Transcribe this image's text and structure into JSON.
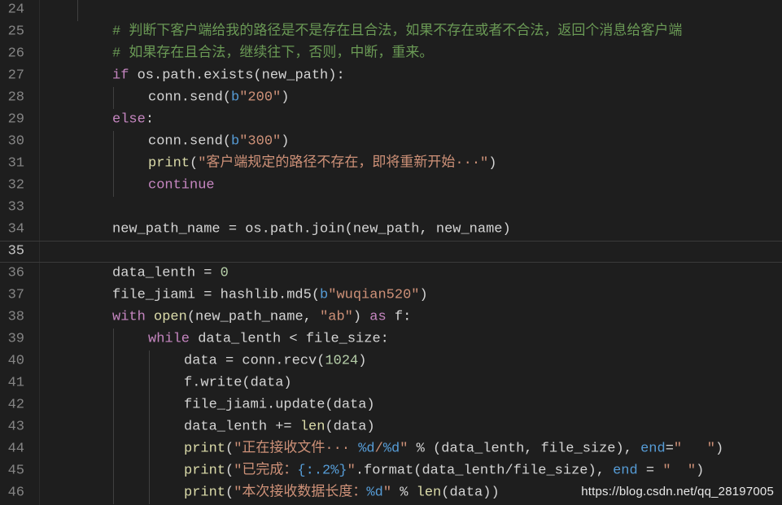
{
  "editor": {
    "lines": [
      {
        "n": "24",
        "indent": 0,
        "tokens": []
      },
      {
        "n": "25",
        "indent": 2,
        "tokens": [
          {
            "t": "# 判断下客户端给我的路径是不是存在且合法，如果不存在或者不合法，返回个消息给客户端",
            "c": "com"
          }
        ]
      },
      {
        "n": "26",
        "indent": 2,
        "tokens": [
          {
            "t": "# 如果存在且合法，继续往下，否则，中断，重来。",
            "c": "com"
          }
        ]
      },
      {
        "n": "27",
        "indent": 2,
        "tokens": [
          {
            "t": "if",
            "c": "kw"
          },
          {
            "t": " os.path.exists(new_path):",
            "c": "id"
          }
        ]
      },
      {
        "n": "28",
        "indent": 3,
        "tokens": [
          {
            "t": "conn.send(",
            "c": "id"
          },
          {
            "t": "b",
            "c": "fmt"
          },
          {
            "t": "\"200\"",
            "c": "str"
          },
          {
            "t": ")",
            "c": "id"
          }
        ]
      },
      {
        "n": "29",
        "indent": 2,
        "tokens": [
          {
            "t": "else",
            "c": "kw"
          },
          {
            "t": ":",
            "c": "id"
          }
        ]
      },
      {
        "n": "30",
        "indent": 3,
        "tokens": [
          {
            "t": "conn.send(",
            "c": "id"
          },
          {
            "t": "b",
            "c": "fmt"
          },
          {
            "t": "\"300\"",
            "c": "str"
          },
          {
            "t": ")",
            "c": "id"
          }
        ]
      },
      {
        "n": "31",
        "indent": 3,
        "tokens": [
          {
            "t": "print",
            "c": "bi"
          },
          {
            "t": "(",
            "c": "id"
          },
          {
            "t": "\"客户端规定的路径不存在，即将重新开始···\"",
            "c": "str"
          },
          {
            "t": ")",
            "c": "id"
          }
        ]
      },
      {
        "n": "32",
        "indent": 3,
        "tokens": [
          {
            "t": "continue",
            "c": "kw"
          }
        ]
      },
      {
        "n": "33",
        "indent": 0,
        "tokens": []
      },
      {
        "n": "34",
        "indent": 2,
        "tokens": [
          {
            "t": "new_path_name = os.path.join(new_path, new_name)",
            "c": "id"
          }
        ]
      },
      {
        "n": "35",
        "indent": 0,
        "tokens": [],
        "current": true
      },
      {
        "n": "36",
        "indent": 2,
        "tokens": [
          {
            "t": "data_lenth = ",
            "c": "id"
          },
          {
            "t": "0",
            "c": "num"
          }
        ]
      },
      {
        "n": "37",
        "indent": 2,
        "tokens": [
          {
            "t": "file_jiami = hashlib.md5(",
            "c": "id"
          },
          {
            "t": "b",
            "c": "fmt"
          },
          {
            "t": "\"wuqian520\"",
            "c": "str"
          },
          {
            "t": ")",
            "c": "id"
          }
        ]
      },
      {
        "n": "38",
        "indent": 2,
        "tokens": [
          {
            "t": "with",
            "c": "kw"
          },
          {
            "t": " ",
            "c": "id"
          },
          {
            "t": "open",
            "c": "bi"
          },
          {
            "t": "(new_path_name, ",
            "c": "id"
          },
          {
            "t": "\"ab\"",
            "c": "str"
          },
          {
            "t": ") ",
            "c": "id"
          },
          {
            "t": "as",
            "c": "kw"
          },
          {
            "t": " f:",
            "c": "id"
          }
        ]
      },
      {
        "n": "39",
        "indent": 3,
        "tokens": [
          {
            "t": "while",
            "c": "kw"
          },
          {
            "t": " data_lenth < file_size:",
            "c": "id"
          }
        ]
      },
      {
        "n": "40",
        "indent": 4,
        "tokens": [
          {
            "t": "data = conn.recv(",
            "c": "id"
          },
          {
            "t": "1024",
            "c": "num"
          },
          {
            "t": ")",
            "c": "id"
          }
        ]
      },
      {
        "n": "41",
        "indent": 4,
        "tokens": [
          {
            "t": "f.write(data)",
            "c": "id"
          }
        ]
      },
      {
        "n": "42",
        "indent": 4,
        "tokens": [
          {
            "t": "file_jiami.update(data)",
            "c": "id"
          }
        ]
      },
      {
        "n": "43",
        "indent": 4,
        "tokens": [
          {
            "t": "data_lenth += ",
            "c": "id"
          },
          {
            "t": "len",
            "c": "bi"
          },
          {
            "t": "(data)",
            "c": "id"
          }
        ]
      },
      {
        "n": "44",
        "indent": 4,
        "tokens": [
          {
            "t": "print",
            "c": "bi"
          },
          {
            "t": "(",
            "c": "id"
          },
          {
            "t": "\"正在接收文件··· ",
            "c": "str"
          },
          {
            "t": "%d",
            "c": "fmt"
          },
          {
            "t": "/",
            "c": "str"
          },
          {
            "t": "%d",
            "c": "fmt"
          },
          {
            "t": "\"",
            "c": "str"
          },
          {
            "t": " % (data_lenth, file_size), ",
            "c": "id"
          },
          {
            "t": "end",
            "c": "fmt"
          },
          {
            "t": "=",
            "c": "id"
          },
          {
            "t": "\"   \"",
            "c": "str"
          },
          {
            "t": ")",
            "c": "id"
          }
        ]
      },
      {
        "n": "45",
        "indent": 4,
        "tokens": [
          {
            "t": "print",
            "c": "bi"
          },
          {
            "t": "(",
            "c": "id"
          },
          {
            "t": "\"已完成：",
            "c": "str"
          },
          {
            "t": "{:.2%}",
            "c": "fmt"
          },
          {
            "t": "\"",
            "c": "str"
          },
          {
            "t": ".format(data_lenth/file_size), ",
            "c": "id"
          },
          {
            "t": "end",
            "c": "fmt"
          },
          {
            "t": " = ",
            "c": "id"
          },
          {
            "t": "\"  \"",
            "c": "str"
          },
          {
            "t": ")",
            "c": "id"
          }
        ]
      },
      {
        "n": "46",
        "indent": 4,
        "tokens": [
          {
            "t": "print",
            "c": "bi"
          },
          {
            "t": "(",
            "c": "id"
          },
          {
            "t": "\"本次接收数据长度：",
            "c": "str"
          },
          {
            "t": "%d",
            "c": "fmt"
          },
          {
            "t": "\"",
            "c": "str"
          },
          {
            "t": " % ",
            "c": "id"
          },
          {
            "t": "len",
            "c": "bi"
          },
          {
            "t": "(data))",
            "c": "id"
          }
        ]
      }
    ]
  },
  "watermark": "https://blog.csdn.net/qq_28197005"
}
